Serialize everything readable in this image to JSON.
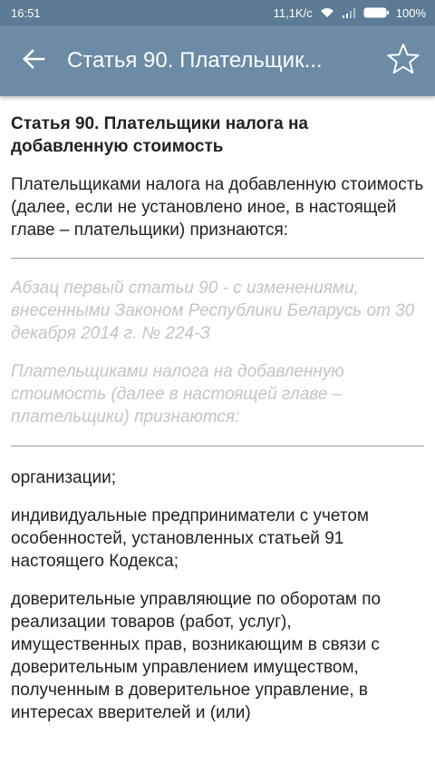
{
  "status_bar": {
    "time": "16:51",
    "speed": "11,1K/c",
    "battery": "100%"
  },
  "app_bar": {
    "back_icon": "arrow-left-icon",
    "title": "Статья 90. Плательщик...",
    "star_icon": "star-outline-icon"
  },
  "article": {
    "title": "Статья 90. Плательщики налога на добавленную стоимость",
    "intro": "Плательщиками налога на добавленную стоимость (далее, если не установлено иное, в настоящей главе – плательщики) признаются:",
    "note_change": "Абзац первый статьи 90 - с изменениями, внесенными Законом Республики Беларусь от 30 декабря 2014 г. № 224-З",
    "note_old_text": "Плательщиками налога на добавленную стоимость (далее в настоящей главе – плательщики) признаются:",
    "items": [
      "организации;",
      "индивидуальные предприниматели с учетом особенностей, установленных статьей 91 настоящего Кодекса;",
      "доверительные управляющие по оборотам по реализации товаров (работ, услуг), имущественных прав, возникающим в связи с доверительным управлением имуществом, полученным в доверительное управление, в интересах вверителей и (или)"
    ]
  },
  "colors": {
    "status_bar": "#5b7c94",
    "app_bar": "#6c8ba5",
    "text": "#222222",
    "note_text": "#c4c4c4"
  }
}
